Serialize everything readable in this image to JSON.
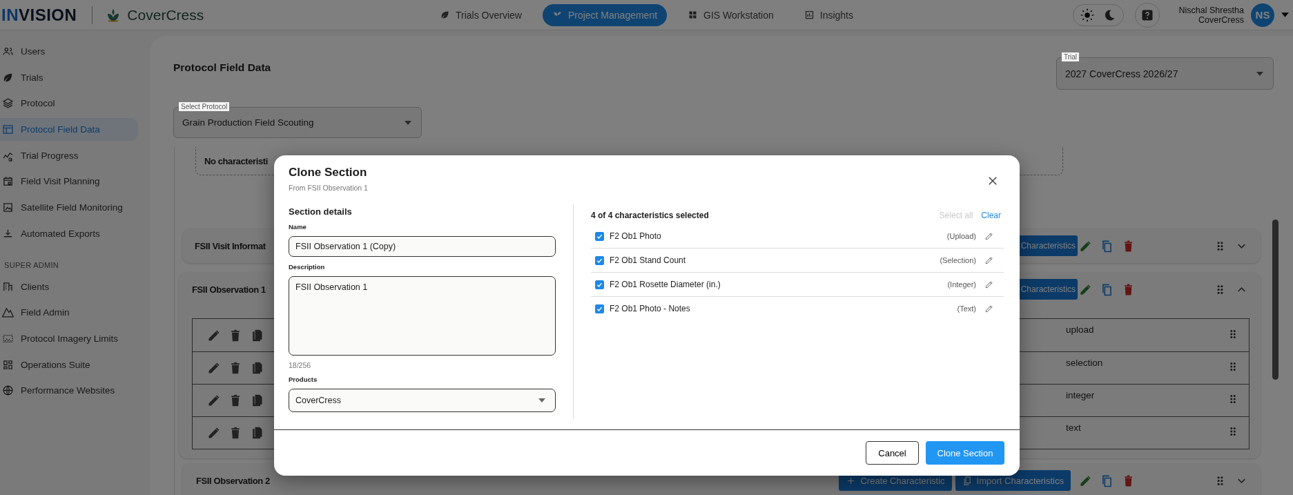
{
  "header": {
    "logo": {
      "accent": "IN",
      "rest": "VISION"
    },
    "brand": "CoverCress",
    "nav": [
      {
        "label": "Trials Overview",
        "selected": false
      },
      {
        "label": "Project Management",
        "selected": true
      },
      {
        "label": "GIS Workstation",
        "selected": false
      },
      {
        "label": "Insights",
        "selected": false
      }
    ],
    "theme": {
      "dark": false
    },
    "user": {
      "name": "Nischal Shrestha",
      "org": "CoverCress",
      "initials": "NS"
    }
  },
  "sidebar": {
    "groups": [
      {
        "items": [
          {
            "label": "Users",
            "selected": false
          },
          {
            "label": "Trials",
            "selected": false
          },
          {
            "label": "Protocol",
            "selected": false
          },
          {
            "label": "Protocol Field Data",
            "selected": true
          },
          {
            "label": "Trial Progress",
            "selected": false
          },
          {
            "label": "Field Visit Planning",
            "selected": false
          },
          {
            "label": "Satellite Field Monitoring",
            "selected": false
          },
          {
            "label": "Automated Exports",
            "selected": false
          }
        ]
      },
      {
        "heading": "SUPER ADMIN",
        "items": [
          {
            "label": "Clients",
            "selected": false
          },
          {
            "label": "Field Admin",
            "selected": false
          },
          {
            "label": "Protocol Imagery Limits",
            "selected": false
          },
          {
            "label": "Operations Suite",
            "selected": false
          },
          {
            "label": "Performance Websites",
            "selected": false
          }
        ]
      }
    ]
  },
  "page": {
    "title": "Protocol Field Data",
    "trial": {
      "label": "Trial",
      "value": "2027 CoverCress 2026/27"
    },
    "protocol_select": {
      "label": "Select Protocol",
      "value": "Grain Production Field Scouting"
    },
    "empty_notice": "No characteristi",
    "sections": [
      {
        "title": "FSII Visit Informat",
        "expanded": false,
        "buttons": [
          {
            "kind": "cut",
            "label": "Characteristics"
          }
        ]
      },
      {
        "title": "FSII Observation 1",
        "expanded": true,
        "buttons": [
          {
            "kind": "cut",
            "label": "Characteristics"
          }
        ],
        "rows": [
          {
            "type": "upload"
          },
          {
            "type": "selection"
          },
          {
            "type": "integer"
          },
          {
            "type": "text"
          }
        ]
      },
      {
        "title": "FSII Observation 2",
        "expanded": false,
        "buttons": [
          {
            "kind": "create",
            "label": "Create Characteristic"
          },
          {
            "kind": "import",
            "label": "Import Characteristics"
          }
        ]
      }
    ]
  },
  "modal": {
    "title": "Clone Section",
    "subtitle": "From FSII Observation 1",
    "section_heading": "Section details",
    "name": {
      "label": "Name",
      "value": "FSII Observation 1 (Copy)"
    },
    "description": {
      "label": "Description",
      "value": "FSII Observation 1",
      "counter": "18/256"
    },
    "products": {
      "label": "Products",
      "value": "CoverCress"
    },
    "summary": "4 of 4 characteristics selected",
    "select_all": {
      "label": "Select all",
      "disabled": true
    },
    "clear": {
      "label": "Clear",
      "disabled": false
    },
    "characteristics": [
      {
        "name": "F2 Ob1 Photo",
        "type": "(Upload)",
        "checked": true
      },
      {
        "name": "F2 Ob1 Stand Count",
        "type": "(Selection)",
        "checked": true
      },
      {
        "name": "F2 Ob1 Rosette Diameter (in.)",
        "type": "(Integer)",
        "checked": true
      },
      {
        "name": "F2 Ob1 Photo - Notes",
        "type": "(Text)",
        "checked": true
      }
    ],
    "buttons": {
      "cancel": "Cancel",
      "confirm": "Clone Section"
    }
  }
}
